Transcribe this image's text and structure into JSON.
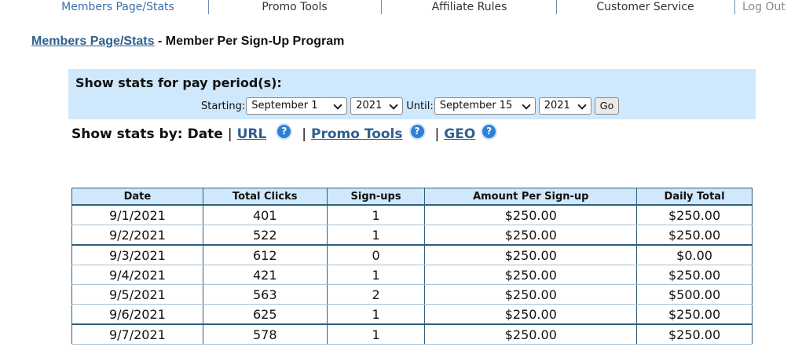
{
  "nav": {
    "items": [
      {
        "label": "Members Page/Stats"
      },
      {
        "label": "Promo Tools"
      },
      {
        "label": "Affiliate Rules"
      },
      {
        "label": "Customer Service"
      },
      {
        "label": "Log Out"
      }
    ]
  },
  "breadcrumb": {
    "link": "Members Page/Stats",
    "separator": " - ",
    "current": "Member Per Sign-Up Program"
  },
  "period": {
    "title": "Show stats for pay period(s):",
    "starting_label": "Starting:",
    "start_day": "September 1",
    "start_year": "2021",
    "until_label": "Until:",
    "end_day": "September 15",
    "end_year": "2021",
    "go_label": "Go"
  },
  "stats_by": {
    "label": "Show stats by:",
    "current": "Date",
    "sep": "|",
    "links": [
      "URL",
      "Promo Tools",
      "GEO"
    ],
    "help_glyph": "?"
  },
  "table": {
    "headers": [
      "Date",
      "Total Clicks",
      "Sign-ups",
      "Amount Per Sign-up",
      "Daily Total"
    ],
    "rows": [
      [
        "9/1/2021",
        "401",
        "1",
        "$250.00",
        "$250.00"
      ],
      [
        "9/2/2021",
        "522",
        "1",
        "$250.00",
        "$250.00"
      ],
      [
        "9/3/2021",
        "612",
        "0",
        "$250.00",
        "$0.00"
      ],
      [
        "9/4/2021",
        "421",
        "1",
        "$250.00",
        "$250.00"
      ],
      [
        "9/5/2021",
        "563",
        "2",
        "$250.00",
        "$500.00"
      ],
      [
        "9/6/2021",
        "625",
        "1",
        "$250.00",
        "$250.00"
      ],
      [
        "9/7/2021",
        "578",
        "1",
        "$250.00",
        "$250.00"
      ]
    ]
  },
  "colors": {
    "panel_bg": "#cfe8fb",
    "link": "#2f5f8f",
    "table_border": "#2f5f7a",
    "help_icon": "#2f7fd6"
  }
}
